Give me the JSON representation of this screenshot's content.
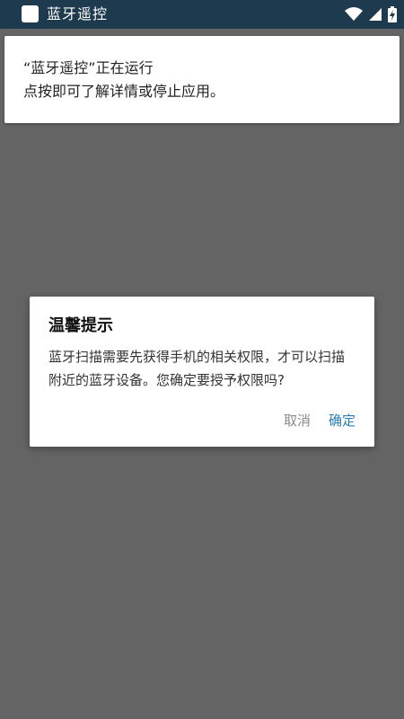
{
  "status_bar": {
    "app_title": "蓝牙遥控",
    "icons": [
      "app-icon",
      "wifi-icon",
      "signal-icon",
      "battery-charging-icon"
    ]
  },
  "notification": {
    "line1": "“蓝牙遥控”正在运行",
    "line2": "点按即可了解详情或停止应用。"
  },
  "dialog": {
    "title": "温馨提示",
    "message": "蓝牙扫描需要先获得手机的相关权限，才可以扫描附近的蓝牙设备。您确定要授予权限吗?",
    "cancel_label": "取消",
    "confirm_label": "确定"
  },
  "colors": {
    "status_bar_bg": "#1e3a4f",
    "overlay_bg": "#646464",
    "accent": "#2a7db5",
    "cancel_text": "#8a8a8a"
  }
}
